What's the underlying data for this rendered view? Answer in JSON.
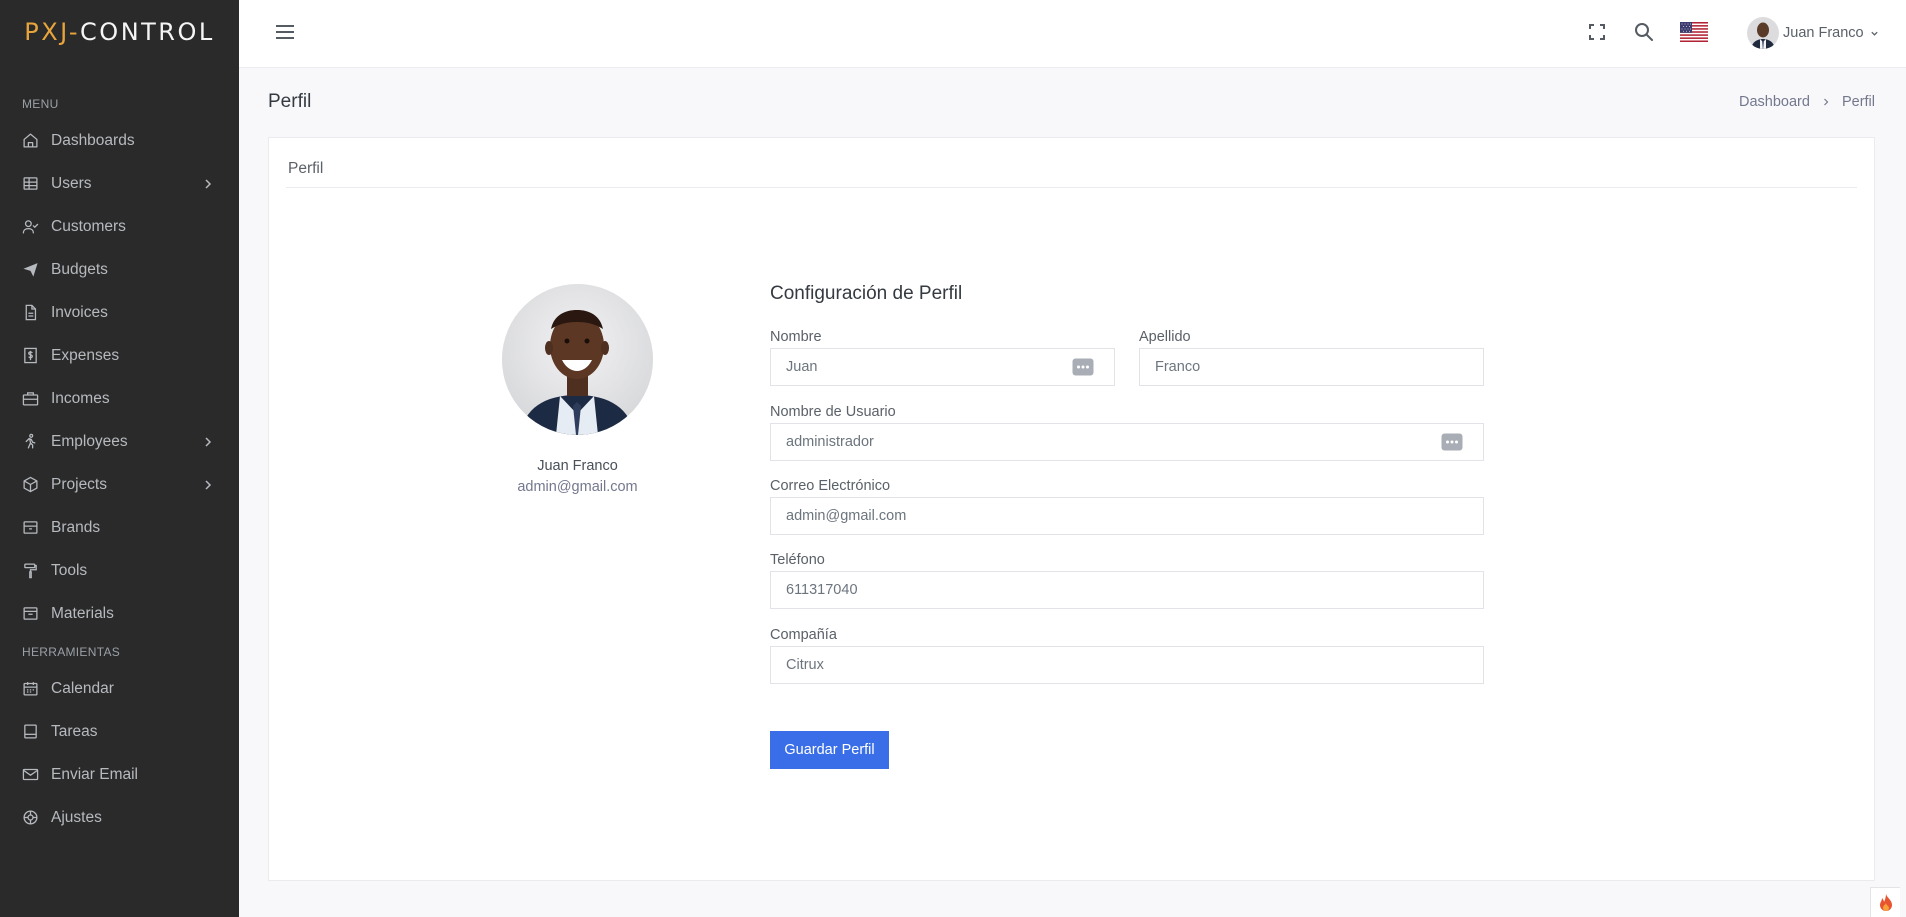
{
  "app": {
    "logo_part1": "PXJ-",
    "logo_part2": "CONTROL"
  },
  "sidebar": {
    "section_menu": "MENU",
    "items": [
      {
        "label": "Dashboards",
        "icon": "home-icon"
      },
      {
        "label": "Users",
        "icon": "grid-icon",
        "has_submenu": true
      },
      {
        "label": "Customers",
        "icon": "user-check-icon"
      },
      {
        "label": "Budgets",
        "icon": "send-icon"
      },
      {
        "label": "Invoices",
        "icon": "file-icon"
      },
      {
        "label": "Expenses",
        "icon": "dollar-file-icon"
      },
      {
        "label": "Incomes",
        "icon": "briefcase-icon"
      },
      {
        "label": "Employees",
        "icon": "walk-icon",
        "has_submenu": true
      },
      {
        "label": "Projects",
        "icon": "box-icon",
        "has_submenu": true
      },
      {
        "label": "Brands",
        "icon": "archive-icon"
      },
      {
        "label": "Tools",
        "icon": "paint-roller-icon"
      },
      {
        "label": "Materials",
        "icon": "package-icon"
      }
    ],
    "section_tools": "HERRAMIENTAS",
    "tools": [
      {
        "label": "Calendar",
        "icon": "calendar-icon"
      },
      {
        "label": "Tareas",
        "icon": "task-icon"
      },
      {
        "label": "Enviar Email",
        "icon": "mail-icon"
      },
      {
        "label": "Ajustes",
        "icon": "settings-icon"
      }
    ]
  },
  "topbar": {
    "user_name": "Juan Franco",
    "language_flag": "us-flag-icon"
  },
  "page": {
    "title": "Perfil",
    "breadcrumb": [
      "Dashboard",
      "Perfil"
    ]
  },
  "card": {
    "title": "Perfil",
    "profile_name": "Juan Franco",
    "profile_email": "admin@gmail.com"
  },
  "form": {
    "heading": "Configuración de Perfil",
    "nombre_label": "Nombre",
    "nombre_value": "Juan",
    "apellido_label": "Apellido",
    "apellido_value": "Franco",
    "usuario_label": "Nombre de Usuario",
    "usuario_value": "administrador",
    "email_label": "Correo Electrónico",
    "email_value": "admin@gmail.com",
    "telefono_label": "Teléfono",
    "telefono_value": "611317040",
    "compania_label": "Compañía",
    "compania_value": "Citrux",
    "save_label": "Guardar Perfil"
  },
  "colors": {
    "sidebar_bg": "#2a2a2a",
    "logo_accent": "#e8a43c",
    "primary_button": "#3a6ee8"
  }
}
